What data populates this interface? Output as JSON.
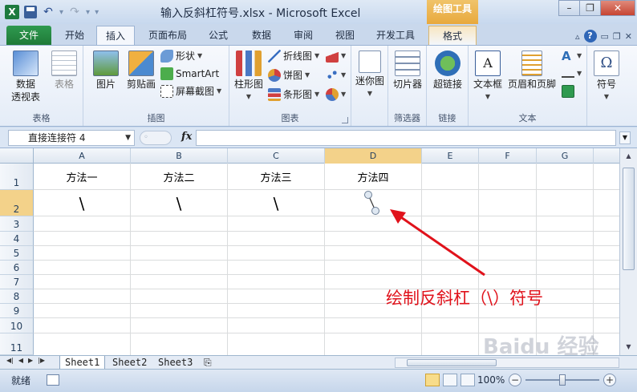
{
  "window": {
    "title": "输入反斜杠符号.xlsx - Microsoft Excel",
    "contextual_tab_group": "绘图工具",
    "minimize": "–",
    "restore": "❐",
    "close": "✕"
  },
  "ribbon_tabs": [
    {
      "label": "文件"
    },
    {
      "label": "开始"
    },
    {
      "label": "插入"
    },
    {
      "label": "页面布局"
    },
    {
      "label": "公式"
    },
    {
      "label": "数据"
    },
    {
      "label": "审阅"
    },
    {
      "label": "视图"
    },
    {
      "label": "开发工具"
    },
    {
      "label": "格式"
    }
  ],
  "active_tab": "插入",
  "ribbon": {
    "tables": {
      "label": "表格",
      "pivot": {
        "line1": "数据",
        "line2": "透视表"
      },
      "table": "表格"
    },
    "illustrations": {
      "label": "插图",
      "picture": "图片",
      "clipart": "剪贴画",
      "shapes": "形状",
      "smartart": "SmartArt",
      "screenshot": "屏幕截图"
    },
    "charts": {
      "label": "图表",
      "column": "柱形图",
      "line": "折线图",
      "pie": "饼图",
      "bar": "条形图"
    },
    "sparklines": {
      "label": "",
      "sparkline": "迷你图"
    },
    "filter": {
      "label": "筛选器",
      "slicer": "切片器"
    },
    "links": {
      "label": "链接",
      "hyperlink": "超链接"
    },
    "text": {
      "label": "文本",
      "textbox": "文本框",
      "header_footer": "页眉和页脚"
    },
    "symbols": {
      "label": "",
      "symbol": "符号"
    }
  },
  "formula_bar": {
    "name_box": "直接连接符 4",
    "fx": "fx",
    "formula": ""
  },
  "columns": [
    "A",
    "B",
    "C",
    "D",
    "E",
    "F",
    "G"
  ],
  "rows": [
    "1",
    "2",
    "3",
    "4",
    "5",
    "6",
    "7",
    "8",
    "9",
    "10",
    "11"
  ],
  "cells": {
    "A1": "方法一",
    "B1": "方法二",
    "C1": "方法三",
    "D1": "方法四",
    "A2": "\\",
    "B2": "\\",
    "C2": "\\"
  },
  "annotation": "绘制反斜杠（\\）符号",
  "sheet_tabs": [
    "Sheet1",
    "Sheet2",
    "Sheet3"
  ],
  "active_sheet": "Sheet1",
  "status": {
    "ready": "就绪",
    "zoom": "100%"
  },
  "watermark": "Baidu 经验",
  "colors": {
    "accent_green": "#1f7a38",
    "annotation_red": "#e0121b",
    "tools_tab_orange": "#e8a93d"
  }
}
